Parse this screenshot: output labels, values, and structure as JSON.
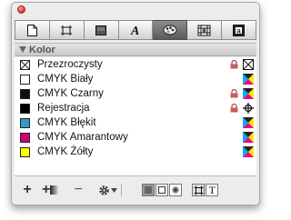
{
  "panel": {
    "section_title": "Kolor",
    "tabs": [
      {
        "name": "page-tab",
        "icon": "page-icon"
      },
      {
        "name": "frame-tab",
        "icon": "frame-icon"
      },
      {
        "name": "box-tab",
        "icon": "box-icon"
      },
      {
        "name": "character-tab",
        "icon": "character-icon",
        "label": "A"
      },
      {
        "name": "colors-tab",
        "icon": "palette-icon",
        "active": true
      },
      {
        "name": "picture-tab",
        "icon": "picture-icon"
      },
      {
        "name": "text-tab",
        "icon": "text-icon"
      }
    ],
    "colors": [
      {
        "name": "Przezroczysty",
        "swatch": "none",
        "locked": true,
        "type": "none"
      },
      {
        "name": "CMYK Biały",
        "swatch": "#ffffff",
        "locked": false,
        "type": "cmyk"
      },
      {
        "name": "CMYK Czarny",
        "swatch": "#111111",
        "locked": true,
        "type": "cmyk"
      },
      {
        "name": "Rejestracja",
        "swatch": "#000000",
        "locked": true,
        "type": "registration"
      },
      {
        "name": "CMYK Błękit",
        "swatch": "#3399cc",
        "locked": false,
        "type": "cmyk"
      },
      {
        "name": "CMYK Amarantowy",
        "swatch": "#cc0077",
        "locked": false,
        "type": "cmyk"
      },
      {
        "name": "CMYK Żółty",
        "swatch": "#ffff00",
        "locked": false,
        "type": "cmyk"
      }
    ],
    "bottom": {
      "add_label": "+",
      "add_gradient_label": "+",
      "remove_label": "−",
      "text_label": "T"
    }
  }
}
